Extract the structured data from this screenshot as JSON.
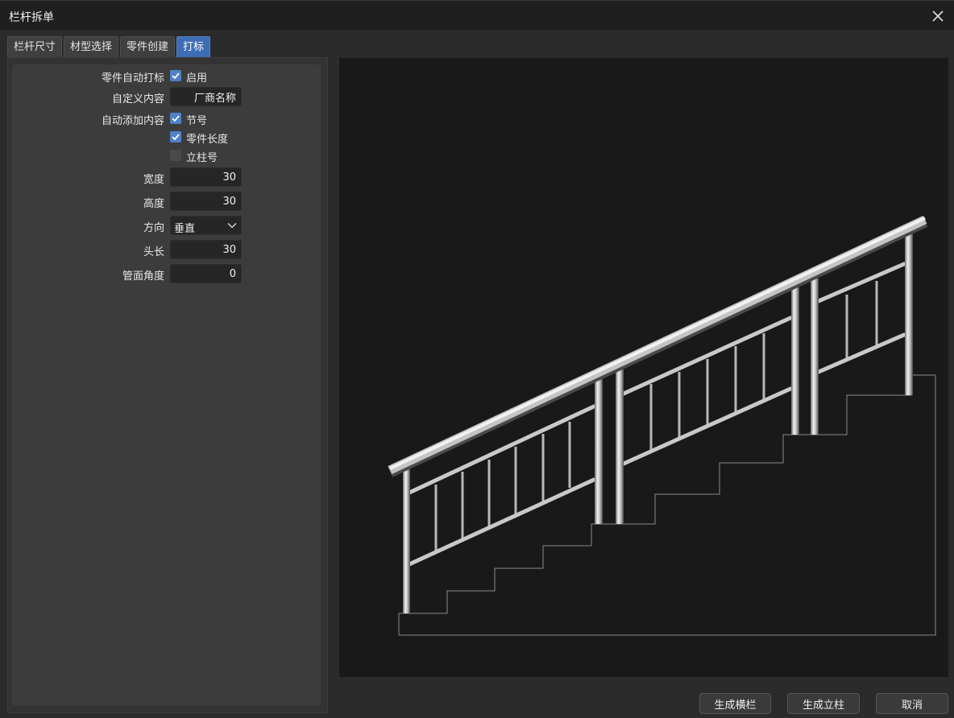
{
  "window": {
    "title": "栏杆拆单"
  },
  "tabs": [
    {
      "label": "栏杆尺寸"
    },
    {
      "label": "材型选择"
    },
    {
      "label": "零件创建"
    },
    {
      "label": "打标",
      "active": true
    }
  ],
  "form": {
    "auto_mark": {
      "label": "零件自动打标",
      "option": "启用",
      "checked": true
    },
    "custom_content": {
      "label": "自定义内容",
      "value": "厂商名称"
    },
    "auto_add": {
      "label": "自动添加内容",
      "options": [
        {
          "label": "节号",
          "checked": true
        },
        {
          "label": "零件长度",
          "checked": true
        },
        {
          "label": "立柱号",
          "checked": false
        }
      ]
    },
    "width": {
      "label": "宽度",
      "value": "30"
    },
    "height": {
      "label": "高度",
      "value": "30"
    },
    "direction": {
      "label": "方向",
      "value": "垂直"
    },
    "head_length": {
      "label": "头长",
      "value": "30"
    },
    "pipe_angle": {
      "label": "管面角度",
      "value": "0"
    }
  },
  "buttons": {
    "generate_rail": "生成横栏",
    "generate_post": "生成立柱",
    "cancel": "取消"
  },
  "colors": {
    "accent": "#3d6db5",
    "check": "#4f81c7",
    "preview_bg": "#191919"
  }
}
